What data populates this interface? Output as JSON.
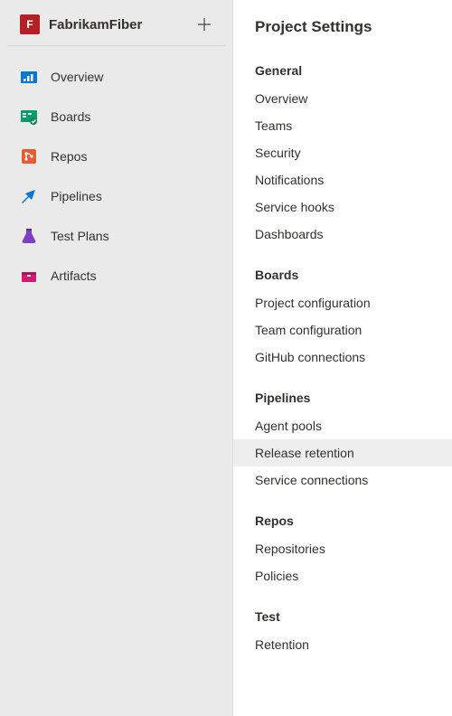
{
  "sidebar": {
    "project_initial": "F",
    "project_name": "FabrikamFiber",
    "items": [
      {
        "label": "Overview",
        "icon": "overview"
      },
      {
        "label": "Boards",
        "icon": "boards"
      },
      {
        "label": "Repos",
        "icon": "repos"
      },
      {
        "label": "Pipelines",
        "icon": "pipelines"
      },
      {
        "label": "Test Plans",
        "icon": "testplans"
      },
      {
        "label": "Artifacts",
        "icon": "artifacts"
      }
    ]
  },
  "settings": {
    "title": "Project Settings",
    "sections": [
      {
        "heading": "General",
        "items": [
          "Overview",
          "Teams",
          "Security",
          "Notifications",
          "Service hooks",
          "Dashboards"
        ]
      },
      {
        "heading": "Boards",
        "items": [
          "Project configuration",
          "Team configuration",
          "GitHub connections"
        ]
      },
      {
        "heading": "Pipelines",
        "items": [
          "Agent pools",
          "Release retention",
          "Service connections"
        ]
      },
      {
        "heading": "Repos",
        "items": [
          "Repositories",
          "Policies"
        ]
      },
      {
        "heading": "Test",
        "items": [
          "Retention"
        ]
      }
    ],
    "selected": "Release retention"
  },
  "colors": {
    "overview": "#0078d4",
    "boards": "#009e6b",
    "repos": "#e85c33",
    "pipelines": "#0078d4",
    "testplans": "#7d3ec9",
    "artifacts": "#d41a74"
  }
}
